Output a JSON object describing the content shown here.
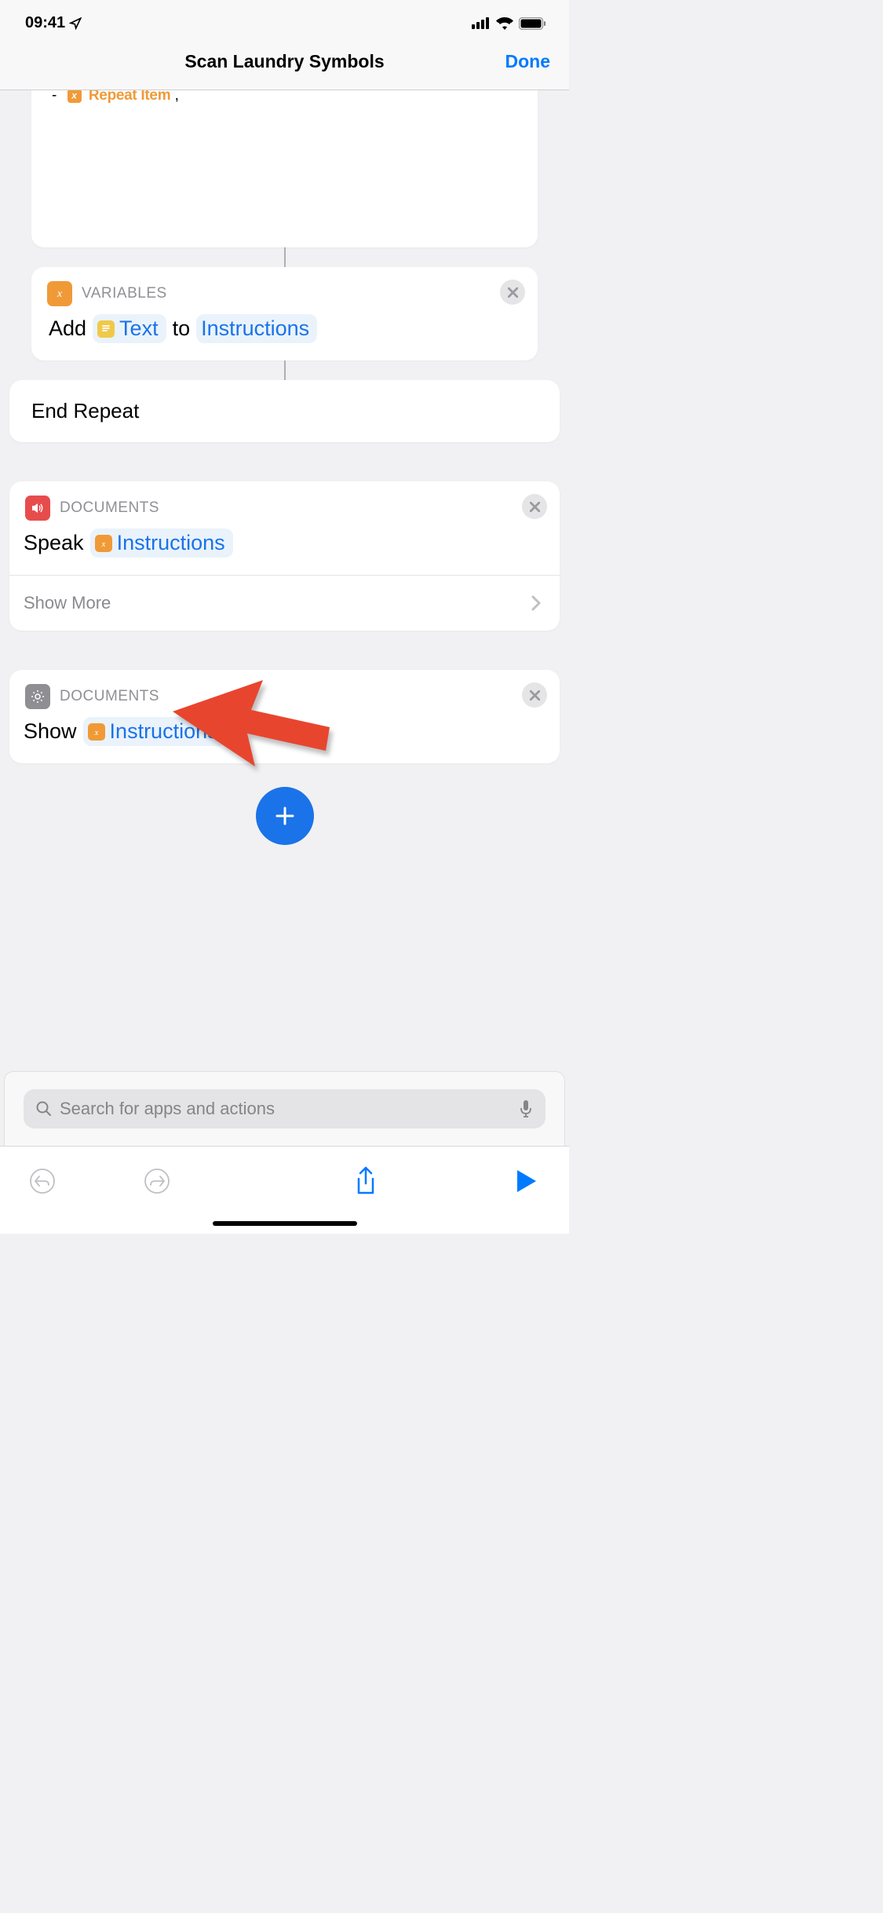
{
  "statusBar": {
    "time": "09:41"
  },
  "header": {
    "title": "Scan Laundry Symbols",
    "done": "Done"
  },
  "partial": {
    "prefix": "-",
    "chipLabel": "Repeat Item",
    "suffix": ","
  },
  "card1": {
    "category": "VARIABLES",
    "action": "Add",
    "token1": "Text",
    "middle": "to",
    "token2": "Instructions"
  },
  "endRepeat": {
    "label": "End Repeat"
  },
  "card2": {
    "category": "DOCUMENTS",
    "action": "Speak",
    "token": "Instructions",
    "showMore": "Show More"
  },
  "card3": {
    "category": "DOCUMENTS",
    "action": "Show",
    "token": "Instructions"
  },
  "search": {
    "placeholder": "Search for apps and actions"
  }
}
